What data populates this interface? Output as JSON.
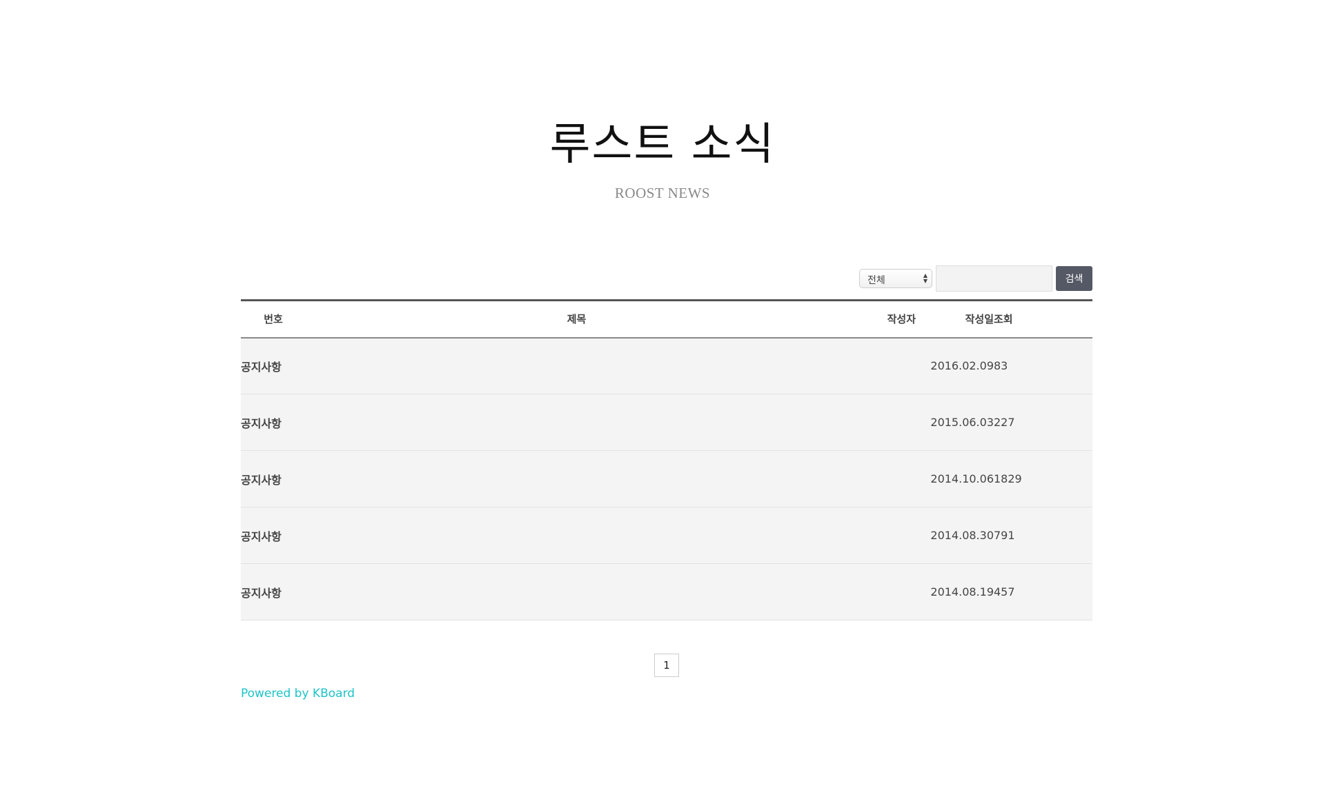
{
  "header": {
    "title": "루스트 소식",
    "subtitle": "ROOST NEWS"
  },
  "search": {
    "select_value": "전체",
    "input_value": "",
    "button_label": "검색"
  },
  "table": {
    "columns": {
      "num": "번호",
      "title": "제목",
      "writer": "작성자",
      "date": "작성일",
      "views": "조회"
    },
    "rows": [
      {
        "num": "공지사항",
        "title": "",
        "writer": "",
        "date": "2016.02.09",
        "views": "83"
      },
      {
        "num": "공지사항",
        "title": "",
        "writer": "",
        "date": "2015.06.03",
        "views": "227"
      },
      {
        "num": "공지사항",
        "title": "",
        "writer": "",
        "date": "2014.10.06",
        "views": "1829"
      },
      {
        "num": "공지사항",
        "title": "",
        "writer": "",
        "date": "2014.08.30",
        "views": "791"
      },
      {
        "num": "공지사항",
        "title": "",
        "writer": "",
        "date": "2014.08.19",
        "views": "457"
      }
    ]
  },
  "pagination": {
    "pages": [
      "1"
    ]
  },
  "footer": {
    "powered_by": "Powered by KBoard"
  }
}
